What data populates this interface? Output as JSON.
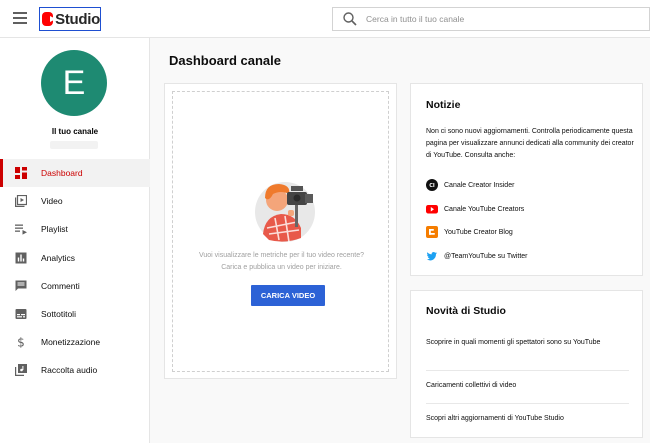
{
  "header": {
    "logo_text": "Studio",
    "search_placeholder": "Cerca in tutto il tuo canale"
  },
  "sidebar": {
    "avatar_letter": "E",
    "channel_label": "Il tuo canale",
    "items": [
      {
        "label": "Dashboard",
        "icon": "dashboard-icon",
        "active": true
      },
      {
        "label": "Video",
        "icon": "video-icon"
      },
      {
        "label": "Playlist",
        "icon": "playlist-icon"
      },
      {
        "label": "Analytics",
        "icon": "analytics-icon"
      },
      {
        "label": "Commenti",
        "icon": "comments-icon"
      },
      {
        "label": "Sottotitoli",
        "icon": "subtitles-icon"
      },
      {
        "label": "Monetizzazione",
        "icon": "dollar-icon"
      },
      {
        "label": "Raccolta audio",
        "icon": "audio-library-icon"
      }
    ]
  },
  "main": {
    "page_title": "Dashboard canale",
    "empty_line1": "Vuoi visualizzare le metriche per il tuo video recente?",
    "empty_line2": "Carica e pubblica un video per iniziare.",
    "upload_button": "CARICA VIDEO"
  },
  "news": {
    "title": "Notizie",
    "body": "Non ci sono nuovi aggiornamenti. Controlla periodicamente questa pagina per visualizzare annunci dedicati alla community dei creator di YouTube. Consulta anche:",
    "links": [
      {
        "label": "Canale Creator Insider",
        "icon": "creator-insider-icon",
        "icon_text": "CI"
      },
      {
        "label": "Canale YouTube Creators",
        "icon": "youtube-icon"
      },
      {
        "label": "YouTube Creator Blog",
        "icon": "blogger-icon"
      },
      {
        "label": "@TeamYouTube su Twitter",
        "icon": "twitter-icon"
      }
    ]
  },
  "studio_news": {
    "title": "Novità di Studio",
    "items": [
      {
        "label": "Scoprire in quali momenti gli spettatori sono su YouTube"
      },
      {
        "label": "Caricamenti collettivi di video"
      },
      {
        "label": "Scopri altri aggiornamenti di YouTube Studio"
      }
    ]
  },
  "colors": {
    "accent_red": "#cc0000",
    "button_blue": "#2c62d6",
    "avatar_green": "#1e8a72"
  }
}
